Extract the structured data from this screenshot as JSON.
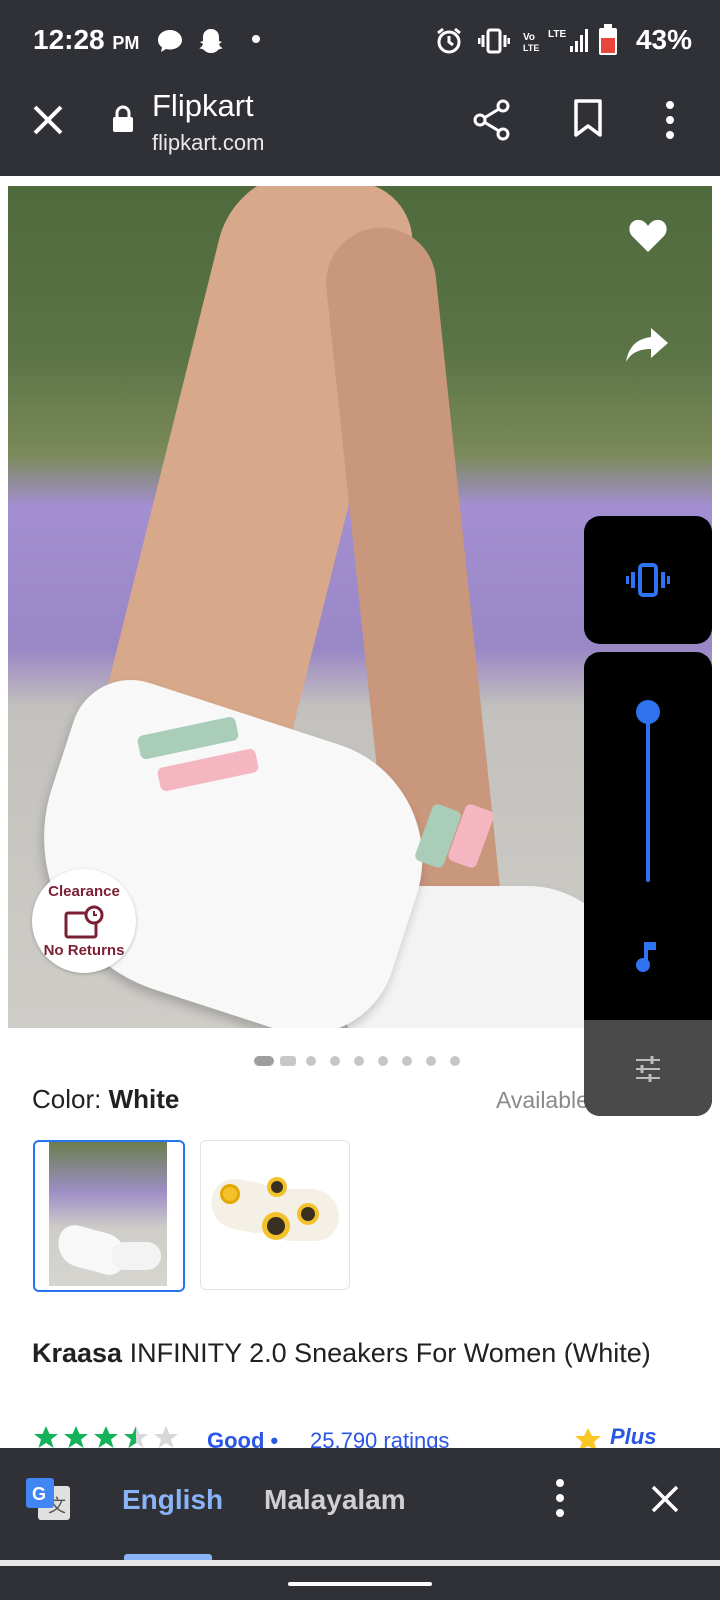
{
  "status_bar": {
    "time": "12:28",
    "ampm": "PM",
    "battery": "43%"
  },
  "browser": {
    "title": "Flipkart",
    "url": "flipkart.com"
  },
  "product": {
    "badge_top": "Clearance",
    "badge_bottom": "No Returns",
    "gallery": {
      "count": 9,
      "current": 1
    },
    "color_label": "Color:",
    "color_value": "White",
    "availability": "Available",
    "brand": "Kraasa",
    "name": "INFINITY 2.0 Sneakers For Women (White)",
    "rating_stars": 3.5,
    "rating_text": "Good •",
    "ratings_count": "25,790 ratings",
    "plus_badge": "Plus"
  },
  "volume_panel": {
    "level": 1.0
  },
  "translate_bar": {
    "source_lang": "English",
    "target_lang": "Malayalam"
  },
  "colors": {
    "accent": "#2874f0",
    "link": "#2a55e5",
    "dark_bar": "#2f3136"
  }
}
